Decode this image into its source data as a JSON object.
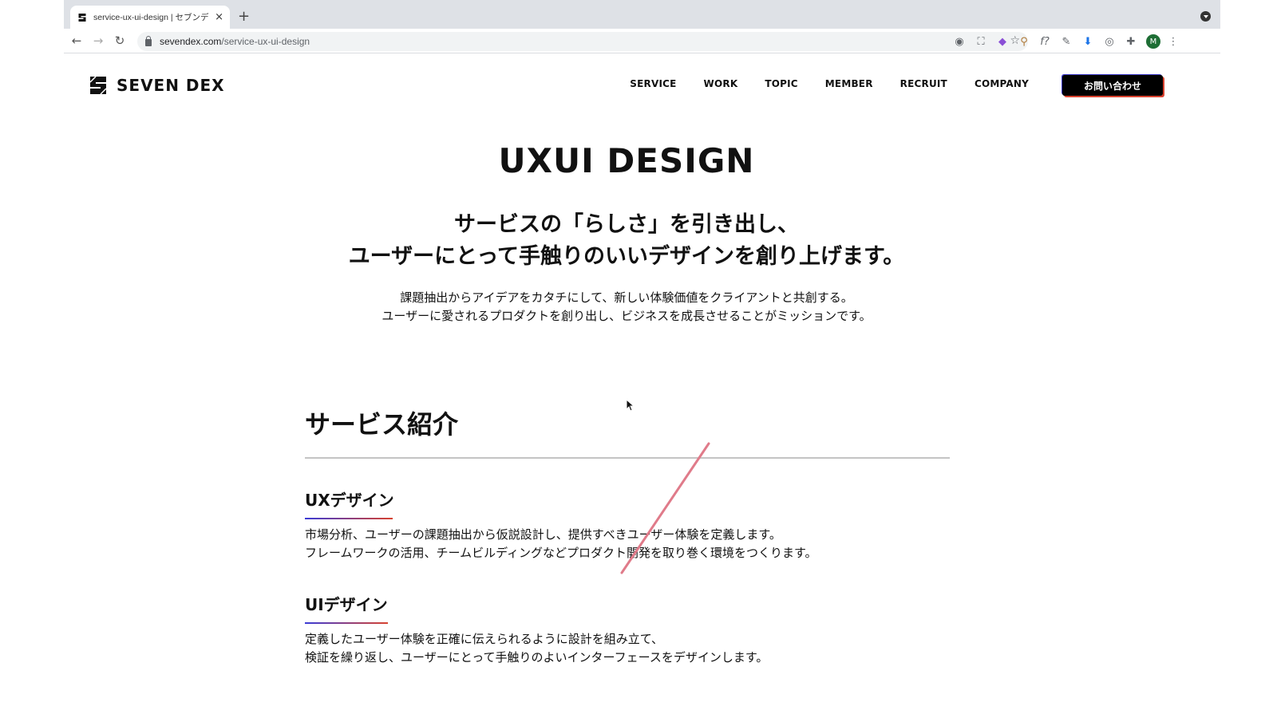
{
  "browser": {
    "tab_title": "service-ux-ui-design | セブンデ",
    "tab_close": "×",
    "new_tab": "+",
    "url_host": "sevendex.com",
    "url_path": "/service-ux-ui-design",
    "back": "←",
    "forward": "→",
    "reload": "↻",
    "bookmark_star": "☆",
    "profile_initial": "M",
    "menu": "⋮",
    "extensions": [
      {
        "icon": "camera-icon",
        "glyph": "◉"
      },
      {
        "icon": "screenshot-icon",
        "glyph": "⛶"
      },
      {
        "icon": "color-extension-icon",
        "glyph": "◆"
      },
      {
        "icon": "brush-icon",
        "glyph": "⚲"
      },
      {
        "icon": "font-identify-icon",
        "glyph": "f?"
      },
      {
        "icon": "eyedropper-icon",
        "glyph": "✎"
      },
      {
        "icon": "download-icon",
        "glyph": "⬇"
      },
      {
        "icon": "record-icon",
        "glyph": "◎"
      },
      {
        "icon": "puzzle-icon",
        "glyph": "✚"
      }
    ]
  },
  "site": {
    "logo_text": "SEVEN DEX",
    "nav": [
      "SERVICE",
      "WORK",
      "TOPIC",
      "MEMBER",
      "RECRUIT",
      "COMPANY"
    ],
    "contact_label": "お問い合わせ"
  },
  "hero": {
    "title": "UXUI DESIGN",
    "lead_line1": "サービスの「らしさ」を引き出し、",
    "lead_line2": "ユーザーにとって手触りのいいデザインを創り上げます。",
    "body_line1": "課題抽出からアイデアをカタチにして、新しい体験価値をクライアントと共創する。",
    "body_line2": "ユーザーに愛されるプロダクトを創り出し、ビジネスを成長させることがミッションです。"
  },
  "services": {
    "section_title": "サービス紹介",
    "items": [
      {
        "heading": "UXデザイン",
        "line1": "市場分析、ユーザーの課題抽出から仮説設計し、提供すべきユーザー体験を定義します。",
        "line2": "フレームワークの活用、チームビルディングなどプロダクト開発を取り巻く環境をつくります。"
      },
      {
        "heading": "UIデザイン",
        "line1": "定義したユーザー体験を正確に伝えられるように設計を組み立て、",
        "line2": "検証を繰り返し、ユーザーにとって手触りのよいインターフェースをデザインします。"
      }
    ]
  },
  "colors": {
    "accent_blue": "#3a3bd6",
    "accent_red": "#d8422f",
    "annotation_stroke": "#e07b8a"
  }
}
